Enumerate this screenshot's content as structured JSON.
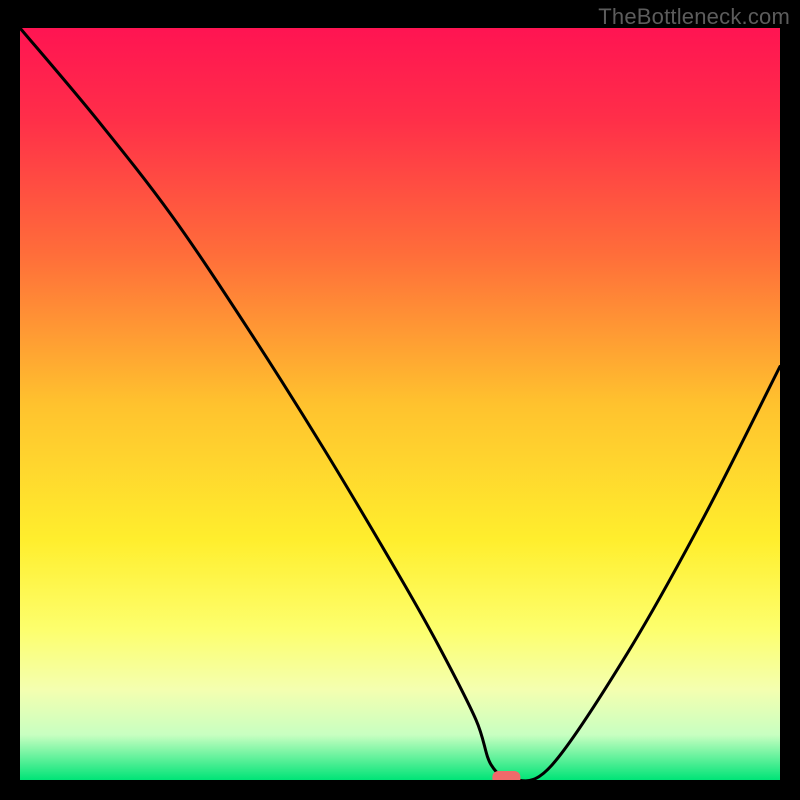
{
  "watermark": "TheBottleneck.com",
  "chart_data": {
    "type": "line",
    "title": "",
    "xlabel": "",
    "ylabel": "",
    "xlim": [
      0,
      100
    ],
    "ylim": [
      0,
      100
    ],
    "x": [
      0,
      10,
      20,
      30,
      40,
      50,
      55,
      60,
      62,
      65,
      70,
      80,
      90,
      100
    ],
    "values": [
      100,
      88,
      75,
      60,
      44,
      27,
      18,
      8,
      2,
      0,
      2,
      17,
      35,
      55
    ],
    "marker": {
      "x": 64,
      "y": 0
    },
    "gradient_stops": [
      {
        "offset": 0.0,
        "color": "#ff1452"
      },
      {
        "offset": 0.12,
        "color": "#ff2e49"
      },
      {
        "offset": 0.3,
        "color": "#ff6d3a"
      },
      {
        "offset": 0.5,
        "color": "#ffc22e"
      },
      {
        "offset": 0.68,
        "color": "#ffee2d"
      },
      {
        "offset": 0.8,
        "color": "#fdff6d"
      },
      {
        "offset": 0.88,
        "color": "#f4ffb0"
      },
      {
        "offset": 0.94,
        "color": "#c8ffc1"
      },
      {
        "offset": 1.0,
        "color": "#00e477"
      }
    ]
  }
}
